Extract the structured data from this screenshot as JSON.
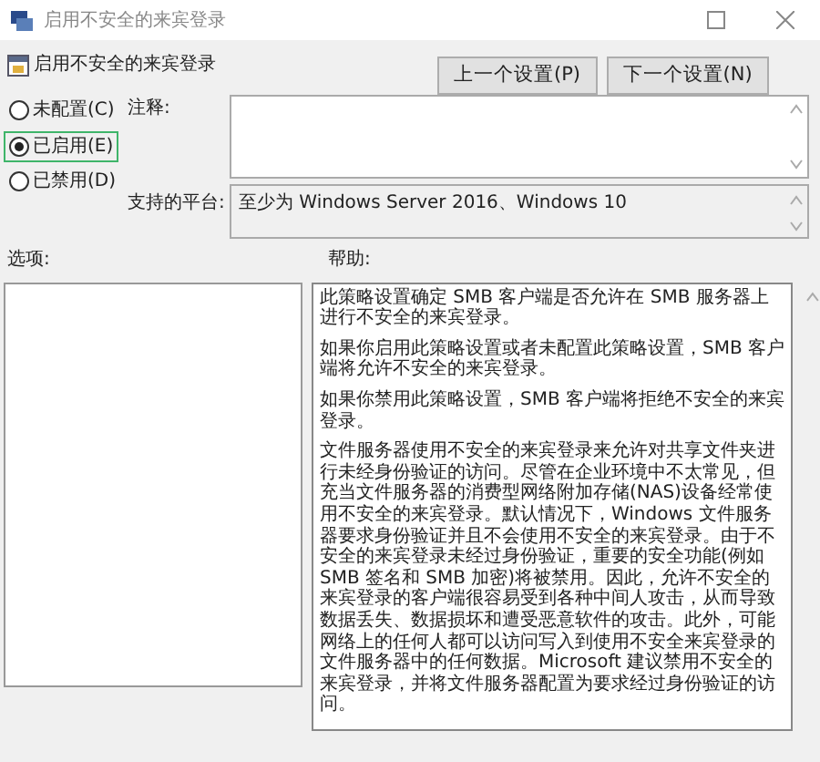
{
  "window": {
    "title": "启用不安全的来宾登录"
  },
  "header": {
    "title": "启用不安全的来宾登录",
    "buttons": [
      "上一个设置(P)",
      "下一个设置(N)"
    ]
  },
  "options": [
    {
      "label": "未配置(C)",
      "selected": false
    },
    {
      "label": "已启用(E)",
      "selected": true
    },
    {
      "label": "已禁用(D)",
      "selected": false
    }
  ],
  "comment": {
    "label": "注释:"
  },
  "platform": {
    "label": "支持的平台:",
    "value": "至少为 Windows Server 2016、Windows 10"
  },
  "options_panel": {
    "label": "选项:"
  },
  "help": {
    "label": "帮助:",
    "paragraphs": [
      "此策略设置确定 SMB 客户端是否允许在 SMB 服务器上进行不安全的来宾登录。",
      "如果你启用此策略设置或者未配置此策略设置，SMB 客户端将允许不安全的来宾登录。",
      "如果你禁用此策略设置，SMB 客户端将拒绝不安全的来宾登录。",
      "文件服务器使用不安全的来宾登录来允许对共享文件夹进行未经身份验证的访问。尽管在企业环境中不太常见，但充当文件服务器的消费型网络附加存储(NAS)设备经常使用不安全的来宾登录。默认情况下，Windows 文件服务器要求身份验证并且不会使用不安全的来宾登录。由于不安全的来宾登录未经过身份验证，重要的安全功能(例如 SMB 签名和 SMB 加密)将被禁用。因此，允许不安全的来宾登录的客户端很容易受到各种中间人攻击，从而导致数据丢失、数据损坏和遭受恶意软件的攻击。此外，可能网络上的任何人都可以访问写入到使用不安全来宾登录的文件服务器中的任何数据。Microsoft 建议禁用不安全的来宾登录，并将文件服务器配置为要求经过身份验证的访问。"
    ]
  }
}
